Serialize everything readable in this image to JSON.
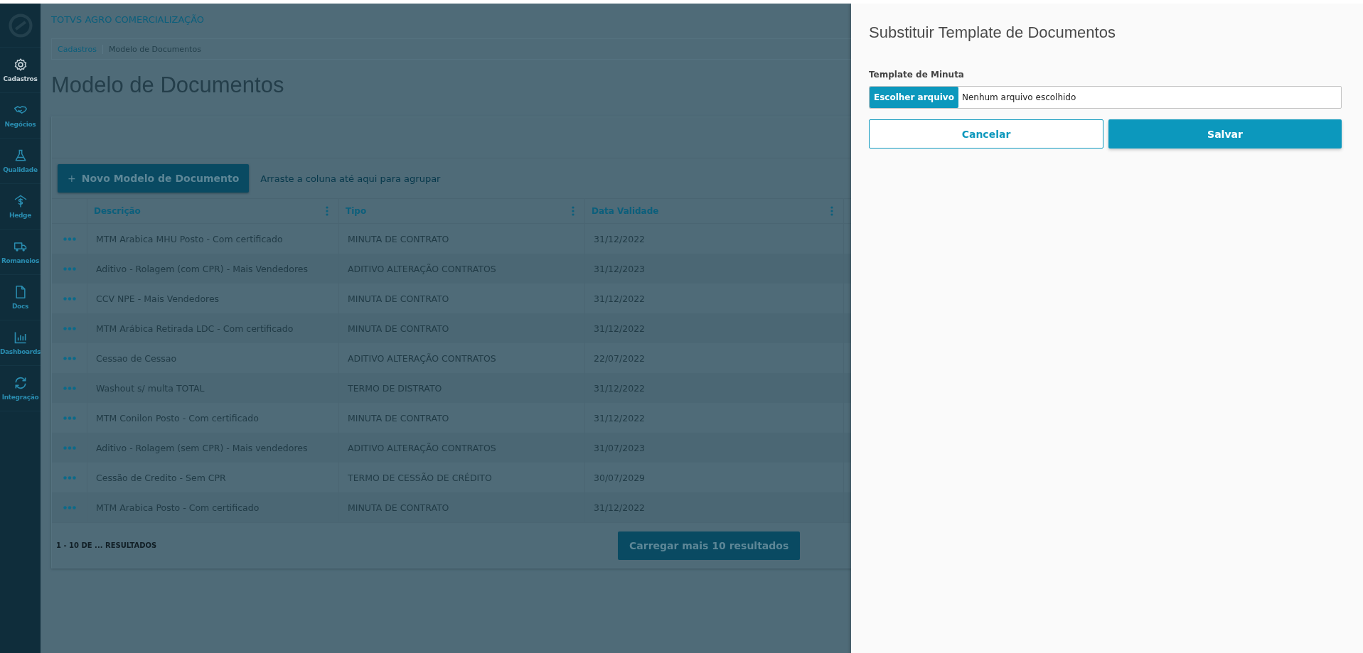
{
  "header": {
    "title": "TOTVS AGRO COMERCIALIZAÇÃO"
  },
  "sidebar": {
    "items": [
      {
        "label": "Cadastros",
        "selected": true
      },
      {
        "label": "Negócios",
        "selected": false
      },
      {
        "label": "Qualidade",
        "selected": false
      },
      {
        "label": "Hedge",
        "selected": false
      },
      {
        "label": "Romaneios",
        "selected": false
      },
      {
        "label": "Docs",
        "selected": false
      },
      {
        "label": "Dashboards",
        "selected": false
      },
      {
        "label": "Integração",
        "selected": false
      }
    ]
  },
  "breadcrumb": [
    "Cadastros",
    "Modelo de Documentos"
  ],
  "page_title": "Modelo de Documentos",
  "toolbar": {
    "new_button": {
      "icon": "+",
      "label": "Novo Modelo de Documento"
    },
    "group_hint": "Arraste a coluna até aqui para agrupar"
  },
  "table": {
    "columns": [
      "Descrição",
      "Tipo",
      "Data Validade"
    ],
    "rows": [
      [
        "MTM Arabica MHU Posto - Com certificado",
        "MINUTA DE CONTRATO",
        "31/12/2022"
      ],
      [
        "Aditivo - Rolagem (com CPR) - Mais Vendedores",
        "ADITIVO ALTERAÇÃO CONTRATOS",
        "31/12/2023"
      ],
      [
        "CCV NPE - Mais Vendedores",
        "MINUTA DE CONTRATO",
        "31/12/2022"
      ],
      [
        "MTM Arábica Retirada LDC - Com certificado",
        "MINUTA DE CONTRATO",
        "31/12/2022"
      ],
      [
        "Cessao de Cessao",
        "ADITIVO ALTERAÇÃO CONTRATOS",
        "22/07/2022"
      ],
      [
        "Washout s/ multa TOTAL",
        "TERMO DE DISTRATO",
        "31/12/2022"
      ],
      [
        "MTM Conilon Posto - Com certificado",
        "MINUTA DE CONTRATO",
        "31/12/2022"
      ],
      [
        "Aditivo - Rolagem (sem CPR) - Mais vendedores",
        "ADITIVO ALTERAÇÃO CONTRATOS",
        "31/07/2023"
      ],
      [
        "Cessão de Credito - Sem CPR",
        "TERMO DE CESSÃO DE CRÉDITO",
        "30/07/2029"
      ],
      [
        "MTM Arabica Posto - Com certificado",
        "MINUTA DE CONTRATO",
        "31/12/2022"
      ]
    ]
  },
  "footer": {
    "result_count": "1 - 10 DE ... RESULTADOS",
    "load_more": "Carregar mais 10 resultados"
  },
  "panel": {
    "title": "Substituir Template de Documentos",
    "field_label": "Template de Minuta",
    "file_button": "Escolher arquivo",
    "file_status": "Nenhum arquivo escolhido",
    "buttons": [
      {
        "label": "Cancelar",
        "kind": "secondary"
      },
      {
        "label": "Salvar",
        "kind": "primary"
      }
    ]
  }
}
